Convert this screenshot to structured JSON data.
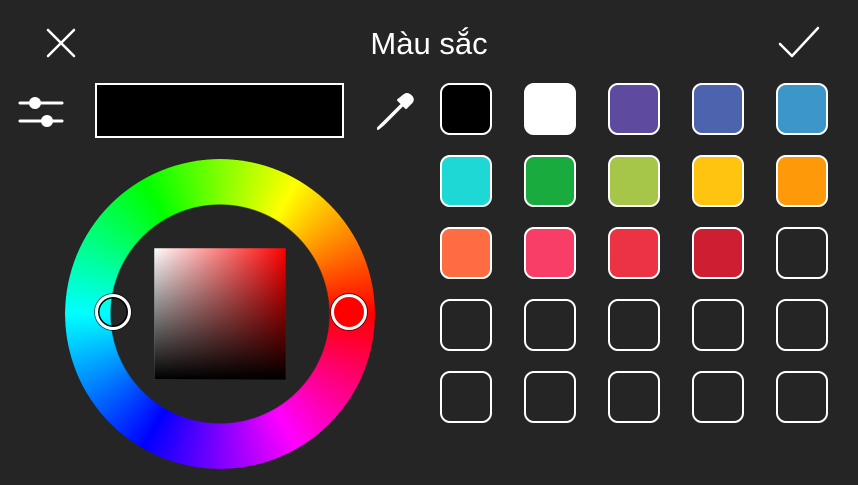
{
  "dialog": {
    "title": "Màu sắc"
  },
  "icons": {
    "close": "close-icon",
    "confirm": "checkmark-icon",
    "sliders": "sliders-icon",
    "eyedropper": "eyedropper-icon"
  },
  "current_color": "#000000",
  "hue_color": "#ff0000",
  "swatches": [
    "#000000",
    "#ffffff",
    "#5e4a9e",
    "#4e63ae",
    "#3c96c7",
    "#1dd8d4",
    "#1aab3f",
    "#a6c64a",
    "#fec40f",
    "#fe9a0a",
    "#fd6c43",
    "#f83d67",
    "#eb3344",
    "#cd1e32",
    null,
    null,
    null,
    null,
    null,
    null,
    null,
    null,
    null,
    null,
    null
  ]
}
